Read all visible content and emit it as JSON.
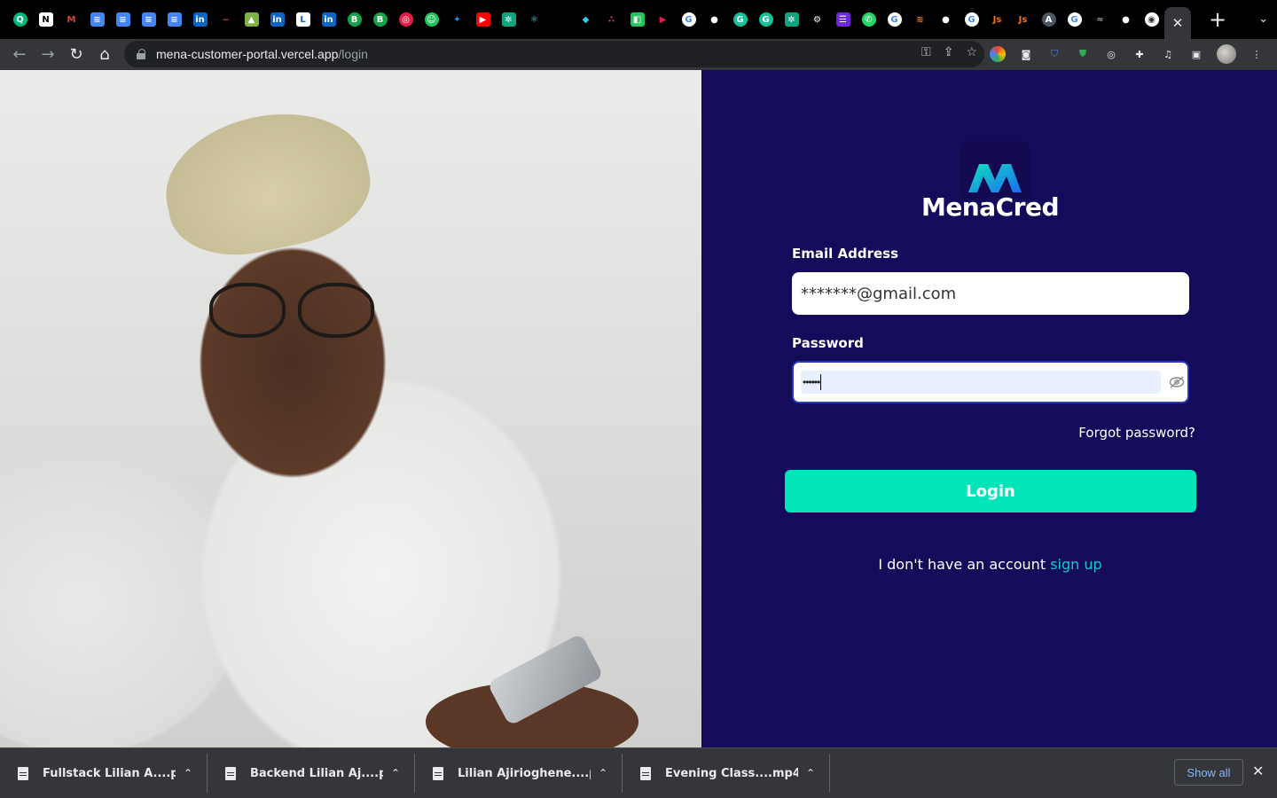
{
  "browser": {
    "tabs_favicons": [
      {
        "name": "quora-tab",
        "glyph": "Q",
        "bg": "#00b67a",
        "round": true
      },
      {
        "name": "notion-tab",
        "glyph": "N",
        "bg": "#ffffff",
        "fg": "#000",
        "round": false
      },
      {
        "name": "gmail-tab",
        "glyph": "M",
        "bg": "#000000",
        "fg": "#ea4335",
        "round": false
      },
      {
        "name": "docs-tab-1",
        "glyph": "≡",
        "bg": "#4285f4",
        "round": false
      },
      {
        "name": "docs-tab-2",
        "glyph": "≡",
        "bg": "#4285f4",
        "round": false
      },
      {
        "name": "docs-tab-3",
        "glyph": "≡",
        "bg": "#4285f4",
        "round": false
      },
      {
        "name": "docs-tab-4",
        "glyph": "≡",
        "bg": "#4285f4",
        "round": false
      },
      {
        "name": "linkedin-tab-1",
        "glyph": "in",
        "bg": "#0a66c2",
        "round": false
      },
      {
        "name": "vercel-tab",
        "glyph": "~",
        "bg": "#000000",
        "fg": "#e53935",
        "round": false
      },
      {
        "name": "android-tab",
        "glyph": "▲",
        "bg": "#7cb342",
        "round": false
      },
      {
        "name": "linkedin-tab-2",
        "glyph": "in",
        "bg": "#0a66c2",
        "round": false
      },
      {
        "name": "ln-tab",
        "glyph": "L",
        "bg": "#ffffff",
        "fg": "#0a66c2",
        "round": false
      },
      {
        "name": "linkedin-tab-3",
        "glyph": "in",
        "bg": "#0a66c2",
        "round": false
      },
      {
        "name": "b-tab-1",
        "glyph": "B",
        "bg": "#16a34a",
        "round": true
      },
      {
        "name": "b-tab-2",
        "glyph": "B",
        "bg": "#16a34a",
        "round": true
      },
      {
        "name": "opera-tab",
        "glyph": "◎",
        "bg": "#e11d48",
        "round": true
      },
      {
        "name": "bot-tab",
        "glyph": "☺",
        "bg": "#22c55e",
        "round": true
      },
      {
        "name": "twitter-tab",
        "glyph": "✦",
        "bg": "#000000",
        "fg": "#1d9bf0",
        "round": false
      },
      {
        "name": "youtube-tab",
        "glyph": "▶",
        "bg": "#ff0000",
        "round": false
      },
      {
        "name": "chatgpt-tab-1",
        "glyph": "✲",
        "bg": "#10a37f",
        "round": false
      },
      {
        "name": "react-tab",
        "glyph": "⚛",
        "bg": "#000000",
        "fg": "#61dafb",
        "round": false
      },
      {
        "name": "blank-tab",
        "glyph": "",
        "bg": "#000000",
        "round": false
      },
      {
        "name": "gem-tab",
        "glyph": "◆",
        "bg": "#000000",
        "fg": "#22d3ee",
        "round": false
      },
      {
        "name": "dots-tab",
        "glyph": "∴",
        "bg": "#000000",
        "fg": "#f43f5e",
        "round": false
      },
      {
        "name": "green-tab",
        "glyph": "◧",
        "bg": "#22c55e",
        "round": false
      },
      {
        "name": "play-tab",
        "glyph": "▶",
        "bg": "#000000",
        "fg": "#e11d48",
        "round": false
      },
      {
        "name": "google-tab-1",
        "glyph": "G",
        "bg": "#ffffff",
        "fg": "#4285f4",
        "round": true
      },
      {
        "name": "github-tab-1",
        "glyph": "●",
        "bg": "#000000",
        "fg": "#ffffff",
        "round": true
      },
      {
        "name": "grammarly-tab-1",
        "glyph": "G",
        "bg": "#15c39a",
        "round": true
      },
      {
        "name": "grammarly-tab-2",
        "glyph": "G",
        "bg": "#15c39a",
        "round": true
      },
      {
        "name": "chatgpt-tab-2",
        "glyph": "✲",
        "bg": "#10a37f",
        "round": false
      },
      {
        "name": "settings-tab",
        "glyph": "⚙",
        "bg": "#000000",
        "fg": "#ffffff",
        "round": false
      },
      {
        "name": "list-tab",
        "glyph": "☰",
        "bg": "#6d28d9",
        "round": false
      },
      {
        "name": "whatsapp-tab",
        "glyph": "✆",
        "bg": "#25d366",
        "round": true
      },
      {
        "name": "google-tab-2",
        "glyph": "G",
        "bg": "#ffffff",
        "fg": "#4285f4",
        "round": true
      },
      {
        "name": "stack-tab",
        "glyph": "≋",
        "bg": "#000000",
        "fg": "#f48024",
        "round": false
      },
      {
        "name": "github-tab-2",
        "glyph": "●",
        "bg": "#000000",
        "fg": "#ffffff",
        "round": true
      },
      {
        "name": "google-tab-3",
        "glyph": "G",
        "bg": "#ffffff",
        "fg": "#4285f4",
        "round": true
      },
      {
        "name": "js-tab-1",
        "glyph": "Js",
        "bg": "#000000",
        "fg": "#f97316",
        "round": false
      },
      {
        "name": "js-tab-2",
        "glyph": "Js",
        "bg": "#000000",
        "fg": "#f97316",
        "round": false
      },
      {
        "name": "aa-tab",
        "glyph": "A",
        "bg": "#4b5563",
        "round": true
      },
      {
        "name": "google-tab-4",
        "glyph": "G",
        "bg": "#ffffff",
        "fg": "#4285f4",
        "round": true
      },
      {
        "name": "wave-tab",
        "glyph": "≈",
        "bg": "#000000",
        "fg": "#9ca3af",
        "round": false
      },
      {
        "name": "github-tab-3",
        "glyph": "●",
        "bg": "#000000",
        "fg": "#ffffff",
        "round": true
      },
      {
        "name": "chrome-tab",
        "glyph": "◉",
        "bg": "#ffffff",
        "fg": "#333",
        "round": true
      }
    ],
    "active_tab_close": "✕",
    "new_tab": "+",
    "tab_search": "⌄",
    "url_host": "mena-customer-portal.vercel.app",
    "url_path": "/login"
  },
  "login": {
    "brand": "MenaCred",
    "email_label": "Email Address",
    "email_value": "*******@gmail.com",
    "password_label": "Password",
    "password_value": "••••••",
    "forgot": "Forgot password?",
    "login_button": "Login",
    "no_account": "I don't have an account",
    "signup": "sign up"
  },
  "colors": {
    "panel_bg": "#150b5b",
    "accent": "#03e4b8",
    "link": "#16c7c9"
  },
  "downloads": {
    "items": [
      {
        "name": "Fullstack Lilian A....pdf",
        "type": "pdf"
      },
      {
        "name": "Backend Lilian Aj....pdf",
        "type": "pdf"
      },
      {
        "name": "Lilian Ajirioghene....pdf",
        "type": "pdf"
      },
      {
        "name": "Evening Class....mp4",
        "type": "mp4"
      }
    ],
    "show_all": "Show all"
  }
}
